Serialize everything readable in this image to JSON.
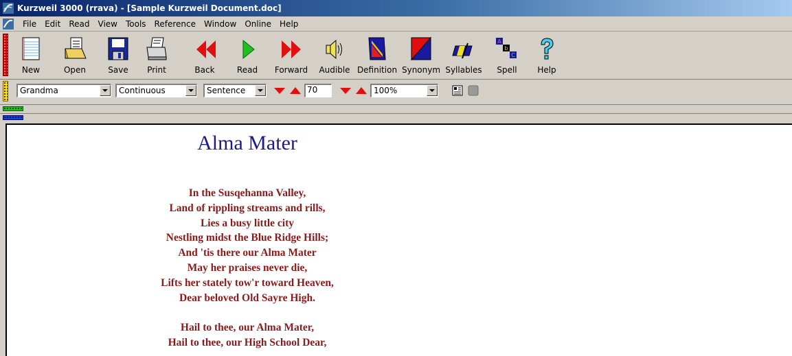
{
  "window": {
    "title": "Kurzweil 3000 (rrava) - [Sample Kurzweil Document.doc]",
    "accent_color": "#0a246a"
  },
  "menu": [
    "File",
    "Edit",
    "Read",
    "View",
    "Tools",
    "Reference",
    "Window",
    "Online",
    "Help"
  ],
  "toolbar": {
    "buttons": [
      {
        "label": "New",
        "icon": "new-document-icon"
      },
      {
        "label": "Open",
        "icon": "open-folder-icon"
      },
      {
        "label": "Save",
        "icon": "save-disk-icon"
      },
      {
        "label": "Print",
        "icon": "printer-icon"
      },
      {
        "label": "Back",
        "icon": "back-red-arrows-icon"
      },
      {
        "label": "Read",
        "icon": "play-green-icon"
      },
      {
        "label": "Forward",
        "icon": "forward-red-arrows-icon"
      },
      {
        "label": "Audible",
        "icon": "speaker-icon"
      },
      {
        "label": "Definition",
        "icon": "definition-book-icon"
      },
      {
        "label": "Synonym",
        "icon": "synonym-icon"
      },
      {
        "label": "Syllables",
        "icon": "syllables-icon"
      },
      {
        "label": "Spell",
        "icon": "spell-abc-icon"
      },
      {
        "label": "Help",
        "icon": "help-question-icon"
      }
    ]
  },
  "reading_bar": {
    "voice": "Grandma",
    "mode": "Continuous",
    "unit": "Sentence",
    "speed": "70",
    "zoom": "100%"
  },
  "document": {
    "title": "Alma Mater",
    "stanza1": [
      "In the Susqehanna Valley,",
      "Land of rippling streams and rills,",
      "Lies a busy little city",
      "Nestling midst the Blue Ridge Hills;",
      "And 'tis there our Alma Mater",
      "May her praises never die,",
      "Lifts her stately tow'r toward Heaven,",
      "Dear beloved Old Sayre High."
    ],
    "stanza2": [
      "Hail to thee, our Alma Mater,",
      "Hail to thee, our High School Dear,"
    ],
    "title_color": "#1a1a8c",
    "text_color": "#8b1a1a"
  }
}
